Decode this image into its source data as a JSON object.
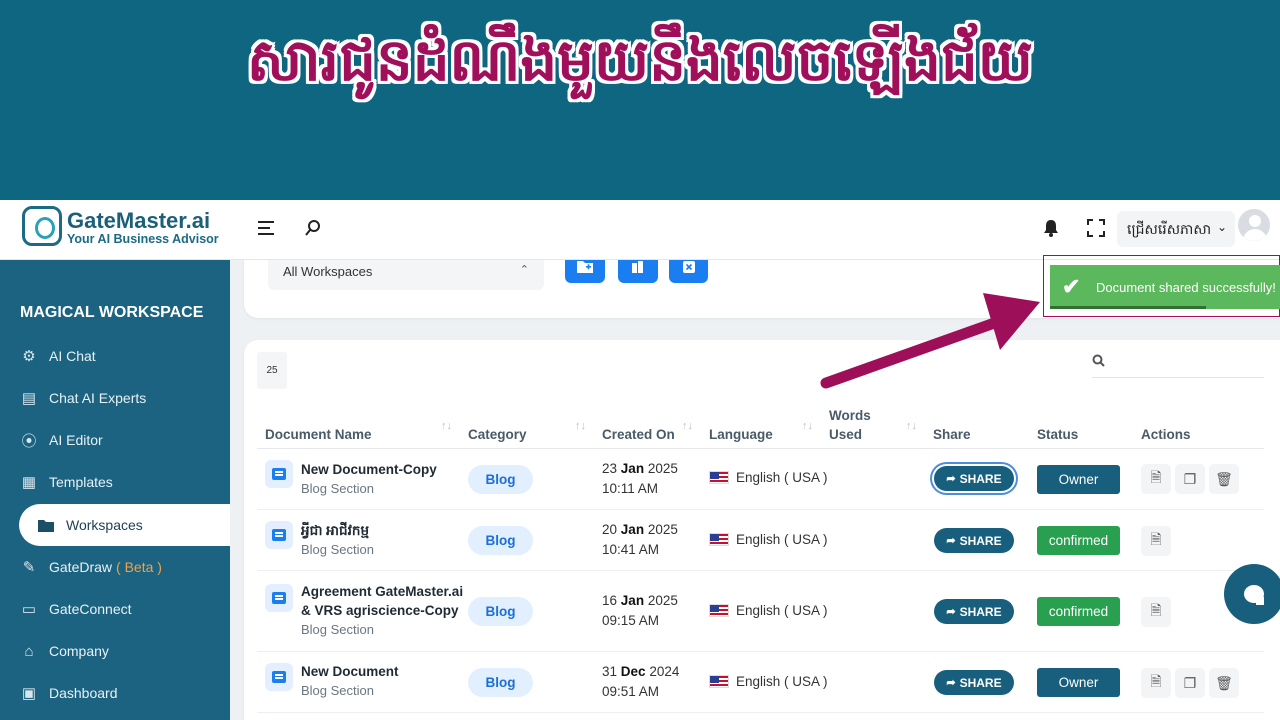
{
  "banner": {
    "title": "សារជូនដំណឹងមួយនឹងលេចឡើងជ័យ"
  },
  "logo": {
    "name": "GateMaster.ai",
    "tagline": "Your AI Business Advisor"
  },
  "header": {
    "language_select": "ជ្រើសរើសភាសា"
  },
  "sidebar": {
    "heading": "MAGICAL WORKSPACE",
    "items": [
      {
        "label": "AI Chat",
        "icon": "robot-icon"
      },
      {
        "label": "Chat AI Experts",
        "icon": "chat-icon"
      },
      {
        "label": "AI Editor",
        "icon": "brain-icon"
      },
      {
        "label": "Templates",
        "icon": "template-icon"
      },
      {
        "label": "Workspaces",
        "icon": "folder-icon",
        "active": true
      },
      {
        "label": "GateDraw",
        "suffix": "( Beta )",
        "icon": "brush-icon"
      },
      {
        "label": "GateConnect",
        "icon": "video-icon"
      },
      {
        "label": "Company",
        "icon": "bank-icon"
      },
      {
        "label": "Dashboard",
        "icon": "dashboard-icon"
      }
    ]
  },
  "workspace_filter": {
    "value": "All Workspaces"
  },
  "table": {
    "page_size": "25",
    "columns": [
      "Document Name",
      "Category",
      "Created On",
      "Language",
      "Words Used",
      "Share",
      "Status",
      "Actions"
    ],
    "rows": [
      {
        "name": "New Document-Copy",
        "section": "Blog Section",
        "category": "Blog",
        "date_day": "23",
        "date_month": "Jan",
        "date_year": "2025",
        "time": "10:11 AM",
        "language": "English ( USA )",
        "share": "SHARE",
        "status": "Owner"
      },
      {
        "name": "អ្វីជា អាជីវកម្ម",
        "section": "Blog Section",
        "category": "Blog",
        "date_day": "20",
        "date_month": "Jan",
        "date_year": "2025",
        "time": "10:41 AM",
        "language": "English ( USA )",
        "share": "SHARE",
        "status": "confirmed"
      },
      {
        "name": "Agreement GateMaster.ai & VRS agriscience-Copy",
        "section": "Blog Section",
        "category": "Blog",
        "date_day": "16",
        "date_month": "Jan",
        "date_year": "2025",
        "time": "09:15 AM",
        "language": "English ( USA )",
        "share": "SHARE",
        "status": "confirmed"
      },
      {
        "name": "New Document",
        "section": "Blog Section",
        "category": "Blog",
        "date_day": "31",
        "date_month": "Dec",
        "date_year": "2024",
        "time": "09:51 AM",
        "language": "English ( USA )",
        "share": "SHARE",
        "status": "Owner"
      }
    ]
  },
  "toast": {
    "message": "Document shared successfully!"
  },
  "colors": {
    "brand": "#175f7d",
    "owner": "#175f7d",
    "confirmed": "#28a04f",
    "toast": "#5cb85c",
    "banner_text": "#a0105a"
  }
}
